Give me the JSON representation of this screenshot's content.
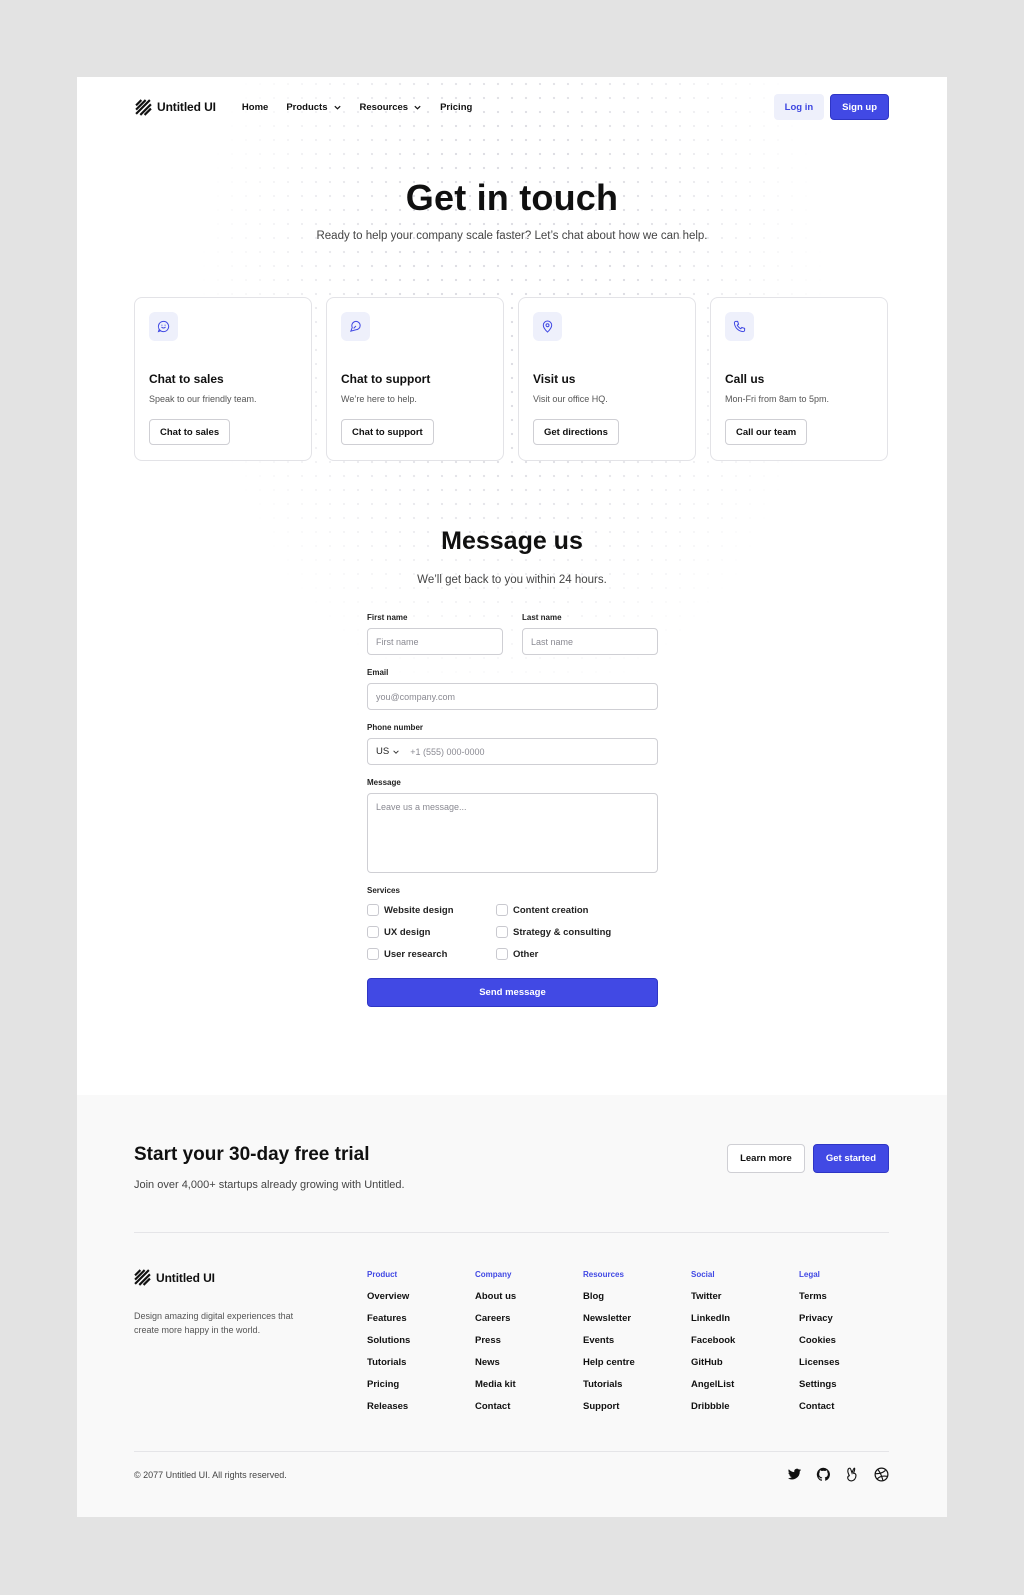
{
  "nav": {
    "brand": "Untitled UI",
    "links": [
      {
        "label": "Home",
        "dropdown": false
      },
      {
        "label": "Products",
        "dropdown": true
      },
      {
        "label": "Resources",
        "dropdown": true
      },
      {
        "label": "Pricing",
        "dropdown": false
      }
    ],
    "login": "Log in",
    "signup": "Sign up"
  },
  "hero": {
    "title": "Get in touch",
    "subtitle": "Ready to help your company scale faster? Let’s chat about how we can help."
  },
  "cards": [
    {
      "icon": "chat-smile-icon",
      "title": "Chat to sales",
      "desc": "Speak to our friendly team.",
      "button": "Chat to sales"
    },
    {
      "icon": "chat-bubble-icon",
      "title": "Chat to support",
      "desc": "We’re here to help.",
      "button": "Chat to support"
    },
    {
      "icon": "map-pin-icon",
      "title": "Visit us",
      "desc": "Visit our office HQ.",
      "button": "Get directions"
    },
    {
      "icon": "phone-icon",
      "title": "Call us",
      "desc": "Mon-Fri from 8am to 5pm.",
      "button": "Call our team"
    }
  ],
  "form": {
    "title": "Message us",
    "subtitle": "We’ll get back to you within 24 hours.",
    "first_name": {
      "label": "First name",
      "placeholder": "First name"
    },
    "last_name": {
      "label": "Last name",
      "placeholder": "Last name"
    },
    "email": {
      "label": "Email",
      "placeholder": "you@company.com"
    },
    "phone": {
      "label": "Phone number",
      "country": "US",
      "placeholder": "+1 (555) 000-0000"
    },
    "message": {
      "label": "Message",
      "placeholder": "Leave us a message..."
    },
    "services_label": "Services",
    "services": [
      "Website design",
      "Content creation",
      "UX design",
      "Strategy & consulting",
      "User research",
      "Other"
    ],
    "submit": "Send message"
  },
  "cta": {
    "title": "Start your 30-day free trial",
    "subtitle": "Join over 4,000+ startups already growing with Untitled.",
    "learn_more": "Learn more",
    "get_started": "Get started"
  },
  "footer": {
    "brand": "Untitled UI",
    "tagline": "Design amazing digital experiences that create more happy in the world.",
    "columns": [
      {
        "heading": "Product",
        "items": [
          "Overview",
          "Features",
          "Solutions",
          "Tutorials",
          "Pricing",
          "Releases"
        ]
      },
      {
        "heading": "Company",
        "items": [
          "About us",
          "Careers",
          "Press",
          "News",
          "Media kit",
          "Contact"
        ]
      },
      {
        "heading": "Resources",
        "items": [
          "Blog",
          "Newsletter",
          "Events",
          "Help centre",
          "Tutorials",
          "Support"
        ]
      },
      {
        "heading": "Social",
        "items": [
          "Twitter",
          "LinkedIn",
          "Facebook",
          "GitHub",
          "AngelList",
          "Dribbble"
        ]
      },
      {
        "heading": "Legal",
        "items": [
          "Terms",
          "Privacy",
          "Cookies",
          "Licenses",
          "Settings",
          "Contact"
        ]
      }
    ],
    "copyright": "© 2077 Untitled UI. All rights reserved.",
    "social_icons": [
      "twitter-icon",
      "github-icon",
      "angellist-icon",
      "dribbble-icon"
    ]
  },
  "colors": {
    "accent": "#4149e4",
    "accent_light": "#eef0fb",
    "page_bg": "#e3e3e3",
    "cta_bg": "#f9f9f9"
  }
}
